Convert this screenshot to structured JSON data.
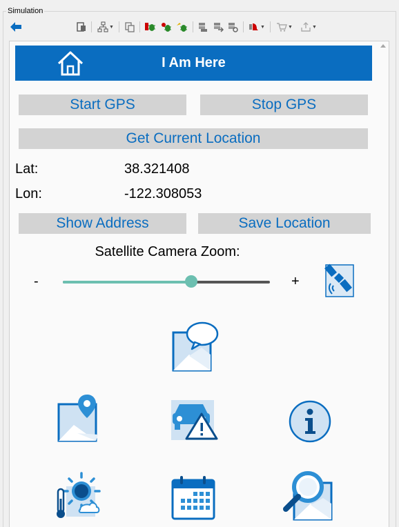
{
  "window": {
    "group_label": "Simulation"
  },
  "toolbar": {
    "icons": [
      "back-arrow-icon",
      "clipboard-icon",
      "hierarchy-icon",
      "copy-icon",
      "bug-red-icon",
      "bug-green-icon",
      "bug-yellow-icon",
      "stack-icon",
      "stack-arrow-icon",
      "stack-refresh-icon",
      "alarm-icon",
      "cart-icon",
      "upload-icon"
    ]
  },
  "app": {
    "title": "I Am Here",
    "buttons": {
      "start_gps": "Start GPS",
      "stop_gps": "Stop GPS",
      "get_location": "Get Current Location",
      "show_address": "Show Address",
      "save_location": "Save Location"
    },
    "lat_label": "Lat:",
    "lat_value": "38.321408",
    "lon_label": "Lon:",
    "lon_value": "-122.308053",
    "zoom": {
      "label": "Satellite Camera Zoom:",
      "minus": "-",
      "plus": "+",
      "value": 0.62
    }
  },
  "colors": {
    "accent": "#0a6dc0",
    "button_bg": "#d3d3d3",
    "slider": "#6cbfb0"
  },
  "icons": [
    "satellite-icon",
    "map-message-icon",
    "map-pin-icon",
    "traffic-warning-icon",
    "info-icon",
    "weather-icon",
    "calendar-icon",
    "map-search-icon"
  ]
}
